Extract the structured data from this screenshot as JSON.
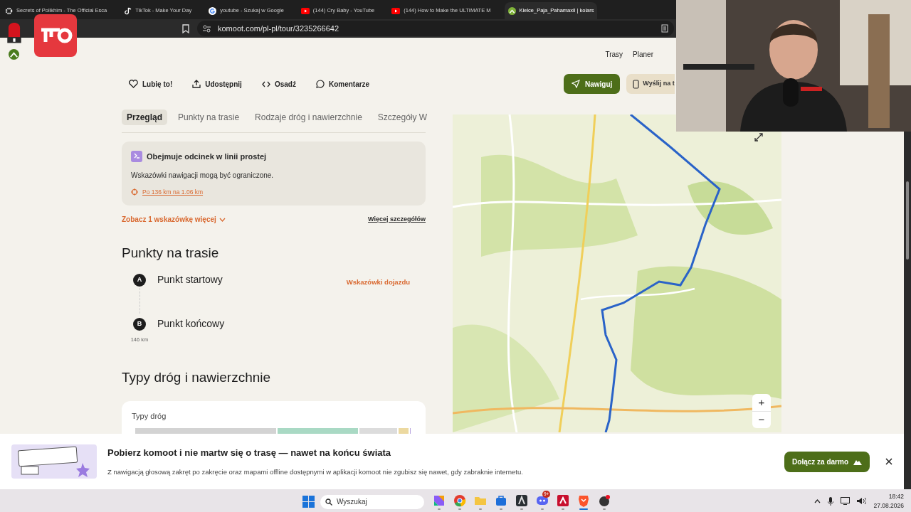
{
  "browser": {
    "tabs": [
      {
        "title": "Secrets of Polikhim - The Official Esca",
        "kind": "gear",
        "selected": false
      },
      {
        "title": "TikTok - Make Your Day",
        "kind": "note",
        "selected": false
      },
      {
        "title": "youtube - Szukaj w Google",
        "kind": "google",
        "selected": false
      },
      {
        "title": "(144) Cry Baby - YouTube",
        "kind": "video",
        "selected": false
      },
      {
        "title": "(144) How to Make the ULTIMATE M",
        "kind": "video",
        "selected": false
      },
      {
        "title": "Kielce_Paja_Pahamaxil | kolars",
        "kind": "komoot",
        "selected": true
      }
    ],
    "address": "komoot.com/pl-pl/tour/3235266642"
  },
  "header": {
    "nav": [
      "Trasy",
      "Planer"
    ]
  },
  "actions": [
    {
      "label": "Lubię to!",
      "kind": "heart"
    },
    {
      "label": "Udostępnij",
      "kind": "share"
    },
    {
      "label": "Osadź",
      "kind": "code"
    },
    {
      "label": "Komentarze",
      "kind": "comment"
    }
  ],
  "primary_buttons": [
    {
      "label": "Nawiguj",
      "kind": "navigate"
    },
    {
      "label": "Wyślij na t",
      "kind": "phone"
    }
  ],
  "section_tabs": [
    {
      "label": "Przegląd",
      "selected": true
    },
    {
      "label": "Punkty na trasie",
      "selected": false
    },
    {
      "label": "Rodzaje dróg i nawierzchnie",
      "selected": false
    },
    {
      "label": "Szczegóły W",
      "selected": false
    }
  ],
  "notice": {
    "title": "Obejmuje odcinek w linii prostej",
    "text": "Wskazówki nawigacji mogą być ograniczone.",
    "link": "Po 136 km na 1.06 km"
  },
  "more_hints": "Zobacz 1 wskazówkę więcej",
  "more_details": "Więcej szczegółów",
  "waypoints_section": {
    "heading": "Punkty na trasie",
    "points": [
      {
        "marker": "A",
        "name": "Punkt startowy",
        "action": "Wskazówki dojazdu"
      },
      {
        "marker": "B",
        "name": "Punkt końcowy",
        "distance": "146 km"
      }
    ]
  },
  "road_types_section": {
    "heading": "Typy dróg i nawierzchnie",
    "card_title": "Typy dróg",
    "segments": [
      {
        "color": "#d3d3d3"
      },
      {
        "color": "#a9d9c4"
      },
      {
        "color": "#dcdcdc"
      },
      {
        "color": "#ecd9a0"
      },
      {
        "color": "#b9a6e0"
      }
    ]
  },
  "map": {
    "zoom_buttons": [
      "+",
      "−"
    ]
  },
  "banner": {
    "title": "Pobierz komoot i nie martw się o trasę — nawet na końcu świata",
    "text": "Z nawigacją głosową zakręt po zakręcie oraz mapami offline dostępnymi w aplikacji komoot nie zgubisz się nawet, gdy zabraknie internetu.",
    "button": "Dołącz za darmo"
  },
  "taskbar": {
    "search_placeholder": "Wyszukaj",
    "apps": [
      {
        "kind": "copilot",
        "selected": false
      },
      {
        "kind": "chrome",
        "selected": false
      },
      {
        "kind": "folder",
        "selected": false
      },
      {
        "kind": "store",
        "selected": false
      },
      {
        "kind": "dark",
        "selected": false
      },
      {
        "kind": "chat",
        "selected": false,
        "badge": "9+"
      },
      {
        "kind": "red",
        "selected": false
      },
      {
        "kind": "lion",
        "selected": true
      },
      {
        "kind": "dot",
        "selected": false
      }
    ],
    "time": "18:42",
    "date": "27.08.2026"
  }
}
